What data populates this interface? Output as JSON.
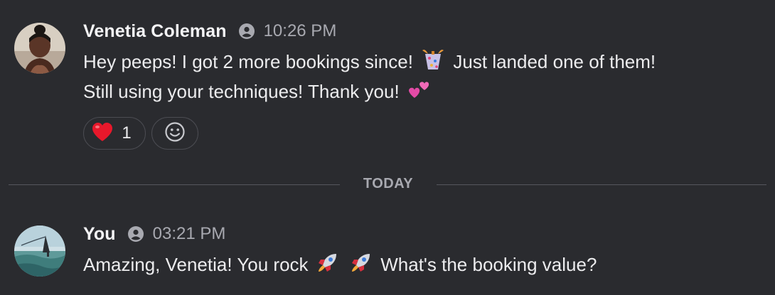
{
  "messages": [
    {
      "author": "Venetia Coleman",
      "status_icon": "user-status-icon",
      "time": "10:26 PM",
      "line1_before": "Hey peeps! I got 2 more bookings since!",
      "line1_emoji": "confetti-icon",
      "line1_after": "Just landed one of them!",
      "line2_before": "Still using your techniques! Thank you!",
      "line2_emoji": "two-hearts-icon",
      "reactions": [
        {
          "icon": "red-heart-icon",
          "count": "1"
        }
      ],
      "add_reaction_icon": "smiley-icon"
    },
    {
      "author": "You",
      "status_icon": "user-status-icon",
      "time": "03:21 PM",
      "text_before": "Amazing, Venetia! You rock",
      "emoji": [
        "rocket-icon",
        "rocket-icon"
      ],
      "text_after": "What's the booking value?"
    }
  ],
  "divider": {
    "label": "TODAY"
  },
  "colors": {
    "background": "#2a2b2f",
    "text": "#ececee",
    "muted": "#a8a9b0",
    "border": "#4b4c52"
  }
}
